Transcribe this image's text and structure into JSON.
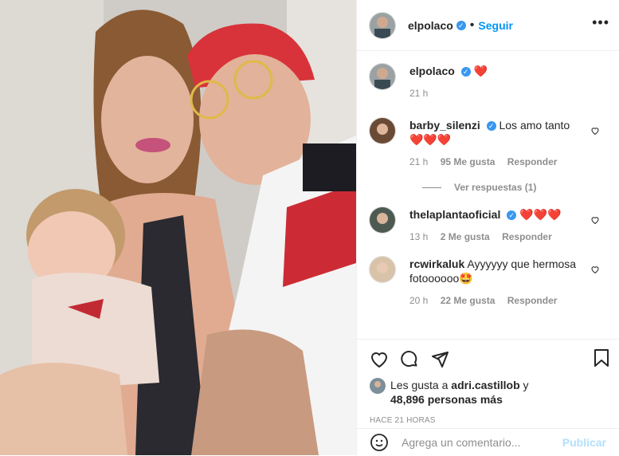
{
  "colors": {
    "accent": "#0095f6",
    "verified": "#3897f0",
    "heart": "#e0202b",
    "muted": "#8e8e8e"
  },
  "header": {
    "username": "elpolaco",
    "follow_label": "Seguir",
    "separator": "•",
    "more": "•••"
  },
  "caption": {
    "username": "elpolaco",
    "text": "❤️",
    "time": "21 h"
  },
  "comments": [
    {
      "username": "barby_silenzi",
      "verified": true,
      "text": "Los amo tanto",
      "emoji": "❤️❤️❤️",
      "time": "21 h",
      "likes": "95 Me gusta",
      "reply": "Responder",
      "view_replies": "Ver respuestas (1)"
    },
    {
      "username": "thelaplantaoficial",
      "verified": true,
      "text": "",
      "emoji": "❤️❤️❤️",
      "time": "13 h",
      "likes": "2 Me gusta",
      "reply": "Responder"
    },
    {
      "username": "rcwirkaluk",
      "verified": false,
      "text": "Ayyyyyy que hermosa fotoooooo🤩",
      "emoji": "",
      "time": "20 h",
      "likes": "22 Me gusta",
      "reply": "Responder"
    }
  ],
  "likes_line": {
    "prefix": "Les gusta a ",
    "user": "adri.castillob",
    "mid": " y",
    "count": "48,896 personas más"
  },
  "timestamp": "HACE 21 HORAS",
  "comment_box": {
    "placeholder": "Agrega un comentario...",
    "publish": "Publicar"
  },
  "icons": [
    "heart-icon",
    "comment-icon",
    "share-icon",
    "bookmark-icon",
    "emoji-icon",
    "more-icon"
  ]
}
